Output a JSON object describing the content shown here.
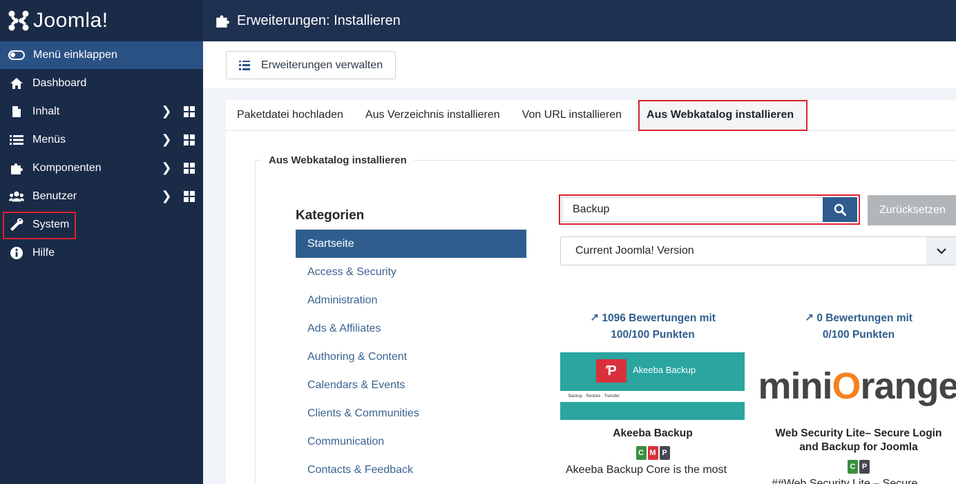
{
  "brand": {
    "name": "Joomla!"
  },
  "sidebar": {
    "collapse_label": "Menü einklappen",
    "items": [
      {
        "label": "Dashboard",
        "icon": "home-icon"
      },
      {
        "label": "Inhalt",
        "icon": "file-icon"
      },
      {
        "label": "Menüs",
        "icon": "list-icon"
      },
      {
        "label": "Komponenten",
        "icon": "puzzle-icon"
      },
      {
        "label": "Benutzer",
        "icon": "users-icon"
      },
      {
        "label": "System",
        "icon": "wrench-icon"
      },
      {
        "label": "Hilfe",
        "icon": "info-icon"
      }
    ]
  },
  "header": {
    "title": "Erweiterungen: Installieren"
  },
  "toolbar": {
    "manage_label": "Erweiterungen verwalten"
  },
  "tabs": [
    {
      "label": "Paketdatei hochladen"
    },
    {
      "label": "Aus Verzeichnis installieren"
    },
    {
      "label": "Von URL installieren"
    },
    {
      "label": "Aus Webkatalog installieren"
    }
  ],
  "panel": {
    "legend": "Aus Webkatalog installieren",
    "categories_title": "Kategorien",
    "categories": [
      "Startseite",
      "Access & Security",
      "Administration",
      "Ads & Affiliates",
      "Authoring & Content",
      "Calendars & Events",
      "Clients & Communities",
      "Communication",
      "Contacts & Feedback"
    ],
    "search": {
      "value": "Backup"
    },
    "reset_label": "Zurücksetzen",
    "version_select": "Current Joomla! Version"
  },
  "cards": [
    {
      "rating_line1": "1096 Bewertungen mit",
      "rating_line2": "100/100 Punkten",
      "image_title": "Akeeba Backup",
      "image_tagline": "Backup · Restore · Transfer",
      "name": "Akeeba Backup",
      "badges": [
        "C",
        "M",
        "P"
      ],
      "description": "Akeeba Backup Core is the most"
    },
    {
      "rating_line1": "0 Bewertungen mit",
      "rating_line2": "0/100 Punkten",
      "logo_text_a": "mini",
      "logo_text_o": "O",
      "logo_text_b": "range",
      "name_line1": "Web Security Lite– Secure Login",
      "name_line2": "and Backup for Joomla",
      "badges": [
        "C",
        "P"
      ],
      "description": "##Web Security Lite – Secure"
    }
  ],
  "colors": {
    "badge_C": "#3a8f3d",
    "badge_M": "#d9313b",
    "badge_P": "#444a50",
    "accent": "#2f5e8e",
    "highlight": "#d9232d"
  }
}
